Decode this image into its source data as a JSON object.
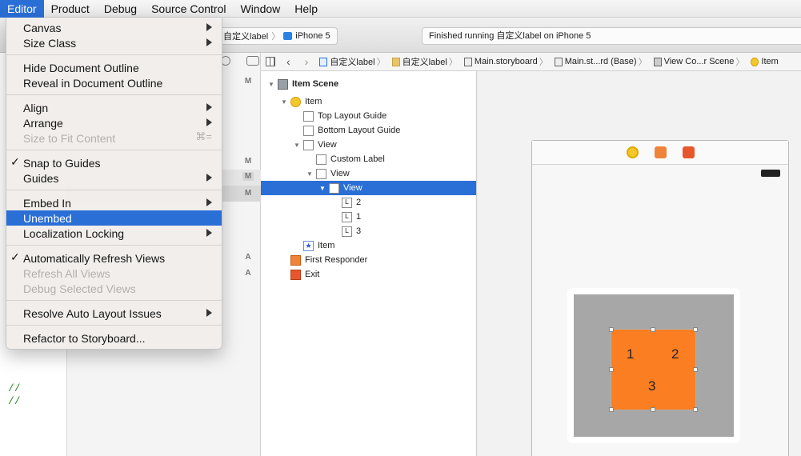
{
  "menubar": [
    "Editor",
    "Product",
    "Debug",
    "Source Control",
    "Window",
    "Help"
  ],
  "toolbar": {
    "scheme": "自定义label",
    "device": "iPhone 5",
    "status": "Finished running 自定义label on iPhone 5"
  },
  "jumpbar": [
    "自定义label",
    "自定义label",
    "Main.storyboard",
    "Main.st...rd (Base)",
    "View Co...r Scene",
    "Item"
  ],
  "source_marks": [
    "M",
    "M",
    "M",
    "A",
    "A"
  ],
  "code_comments": [
    "//",
    "//"
  ],
  "outline": [
    {
      "label": "Item Scene",
      "icon": "scene-icon"
    },
    {
      "label": "Item",
      "icon": "view-controller-icon"
    },
    {
      "label": "Top Layout Guide",
      "icon": "layout-guide-icon"
    },
    {
      "label": "Bottom Layout Guide",
      "icon": "layout-guide-icon"
    },
    {
      "label": "View",
      "icon": "view-icon"
    },
    {
      "label": "Custom Label",
      "icon": "view-icon"
    },
    {
      "label": "View",
      "icon": "view-icon"
    },
    {
      "label": "View",
      "icon": "view-icon",
      "selected": true
    },
    {
      "label": "2",
      "icon": "label-icon"
    },
    {
      "label": "1",
      "icon": "label-icon"
    },
    {
      "label": "3",
      "icon": "label-icon"
    },
    {
      "label": "Item",
      "icon": "tab-bar-item-icon"
    },
    {
      "label": "First Responder",
      "icon": "first-responder-icon"
    },
    {
      "label": "Exit",
      "icon": "exit-icon"
    }
  ],
  "canvas": {
    "labels": [
      "1",
      "2",
      "3"
    ],
    "orange_color": "#fc7e22",
    "gray_color": "#a7a7a7"
  },
  "menu": {
    "canvas": "Canvas",
    "size_class": "Size Class",
    "hide_outline": "Hide Document Outline",
    "reveal_outline": "Reveal in Document Outline",
    "align": "Align",
    "arrange": "Arrange",
    "size_to_fit": "Size to Fit Content",
    "size_to_fit_shortcut": "⌘=",
    "snap_to_guides": "Snap to Guides",
    "guides": "Guides",
    "embed_in": "Embed In",
    "unembed": "Unembed",
    "localization_locking": "Localization Locking",
    "auto_refresh": "Automatically Refresh Views",
    "refresh_all": "Refresh All Views",
    "debug_selected": "Debug Selected Views",
    "resolve_auto_layout": "Resolve Auto Layout Issues",
    "refactor": "Refactor to Storyboard..."
  }
}
